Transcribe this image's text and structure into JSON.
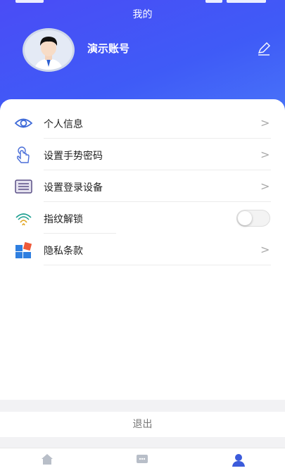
{
  "header": {
    "title": "我的",
    "account_name": "演示账号"
  },
  "menu": {
    "items": [
      {
        "label": "个人信息",
        "icon": "eye-icon",
        "control": "chevron"
      },
      {
        "label": "设置手势密码",
        "icon": "gesture-hand-icon",
        "control": "chevron"
      },
      {
        "label": "设置登录设备",
        "icon": "device-list-icon",
        "control": "chevron"
      },
      {
        "label": "指纹解锁",
        "icon": "fingerprint-icon",
        "control": "toggle",
        "enabled": false
      },
      {
        "label": "隐私条款",
        "icon": "privacy-tiles-icon",
        "control": "chevron"
      }
    ]
  },
  "chevron_glyph": ">",
  "logout_label": "退出",
  "tabbar": {
    "icons": [
      "home-icon",
      "message-icon",
      "user-icon"
    ],
    "active_index": 2
  },
  "colors": {
    "header_gradient_start": "#4a4cf6",
    "header_gradient_end": "#4a78f8",
    "active_tab": "#3b5bdb"
  }
}
